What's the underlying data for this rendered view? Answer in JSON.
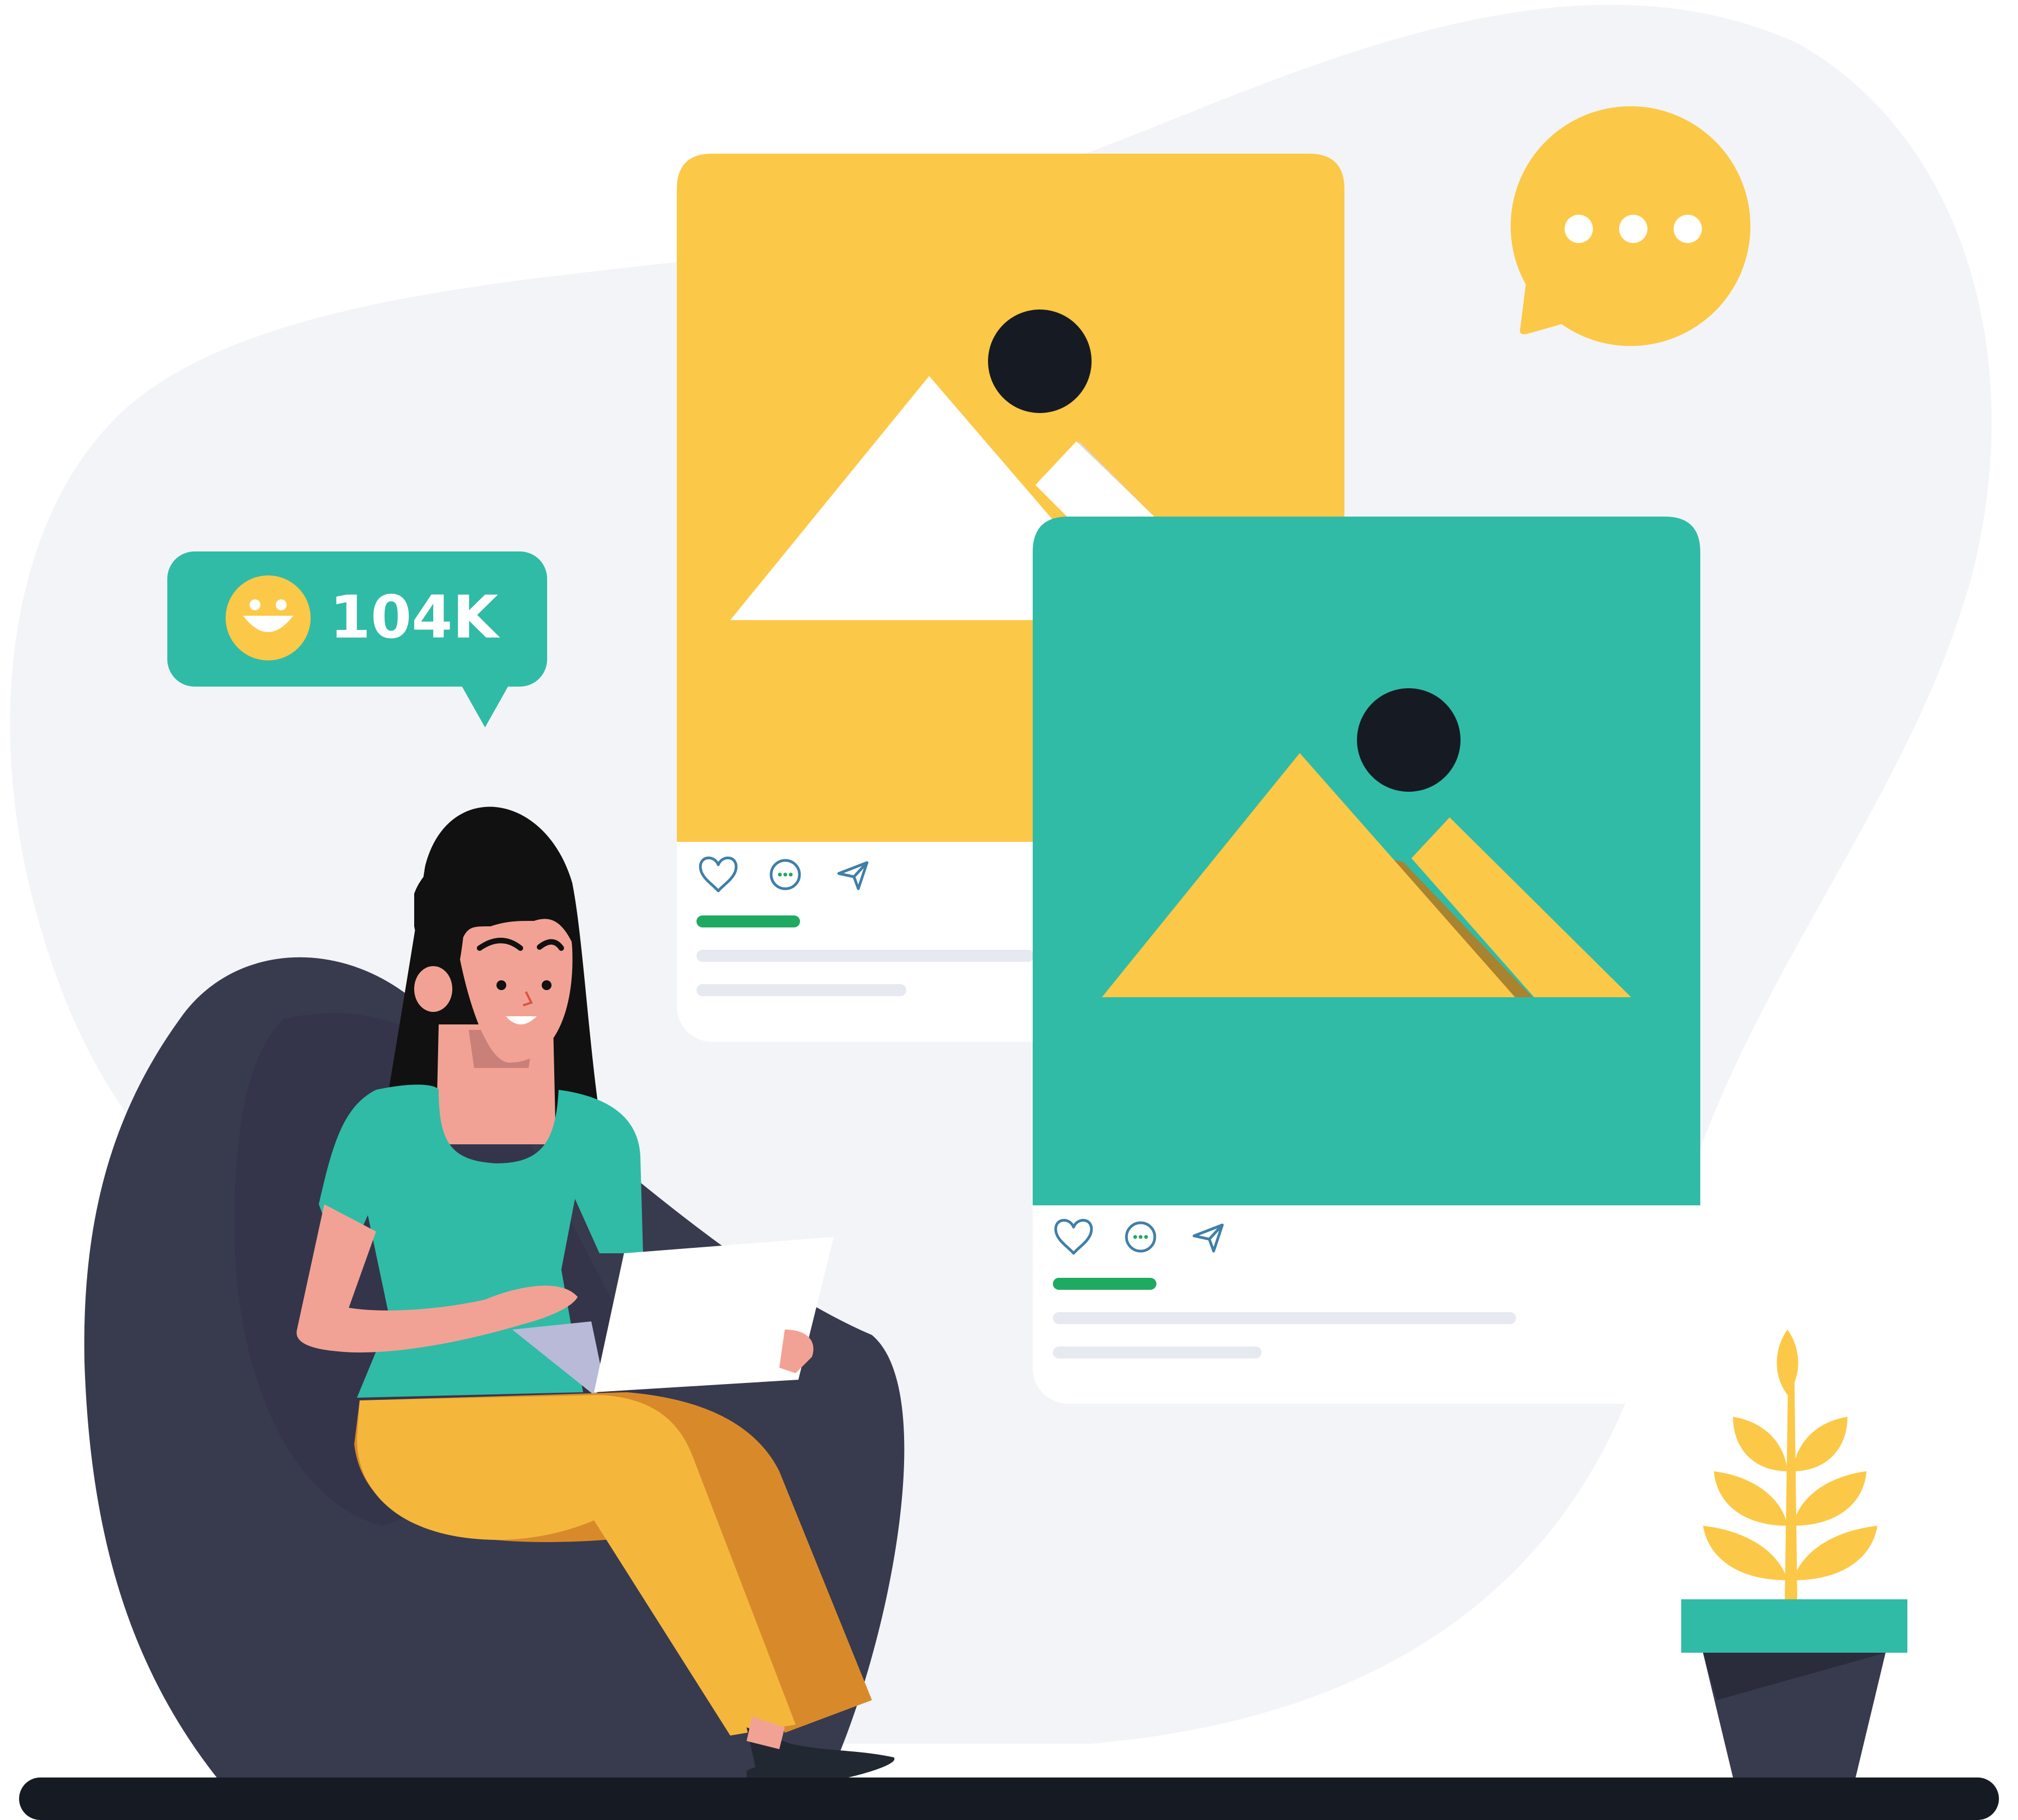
{
  "like_badge": {
    "count": "104K"
  },
  "colors": {
    "blob": "#f3f4f7",
    "yellow": "#fcc847",
    "teal": "#30bba7",
    "dark": "#161b23",
    "chair": "#383a4e",
    "skin": "#f2a294",
    "pants": "#f4b73c",
    "pants_shadow": "#d88a2a",
    "green_bar": "#1faa62",
    "gray_bar": "#e6e9f0",
    "icon_stroke": "#3f7fa8",
    "ground": "#161b23"
  },
  "icons": [
    "heart-icon",
    "comment-icon",
    "send-icon",
    "speech-bubble-icon",
    "smiley-icon"
  ]
}
